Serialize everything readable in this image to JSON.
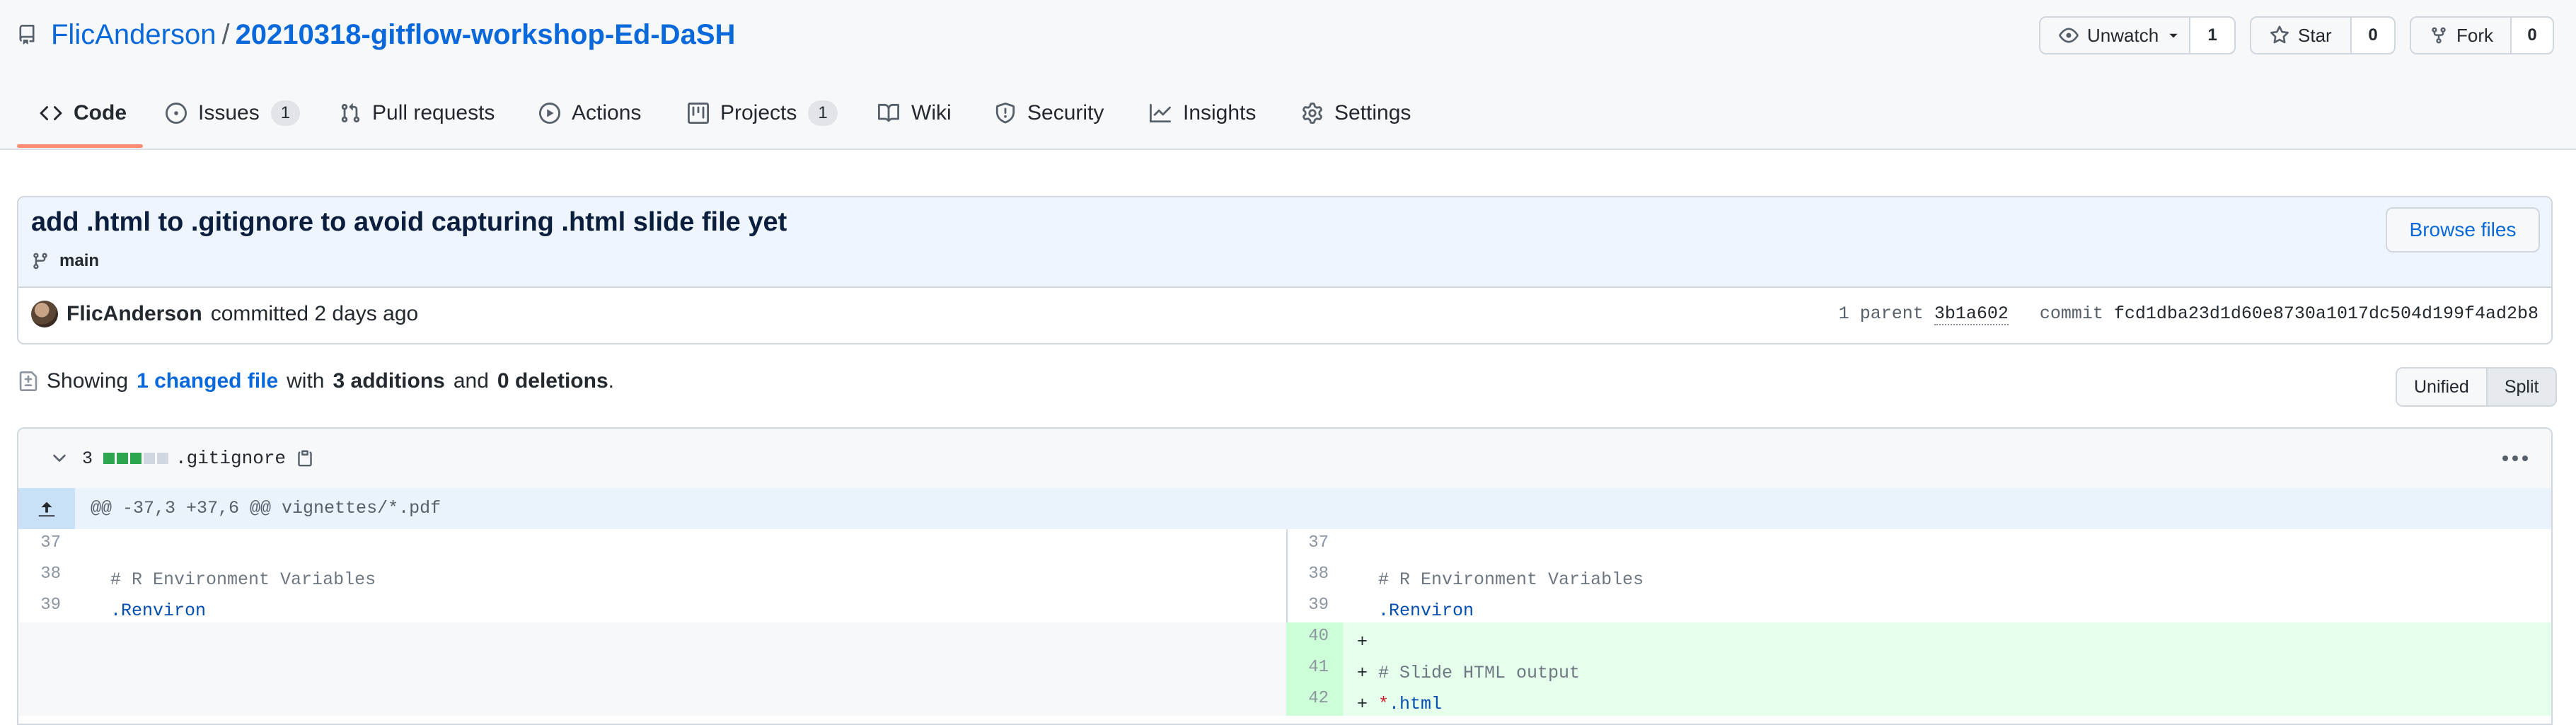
{
  "repo": {
    "owner": "FlicAnderson",
    "separator": "/",
    "name": "20210318-gitflow-workshop-Ed-DaSH"
  },
  "actions": {
    "unwatch": {
      "label": "Unwatch",
      "count": "1"
    },
    "star": {
      "label": "Star",
      "count": "0"
    },
    "fork": {
      "label": "Fork",
      "count": "0"
    }
  },
  "tabs": [
    {
      "label": "Code",
      "icon": "code-icon"
    },
    {
      "label": "Issues",
      "count": "1",
      "icon": "issue-icon"
    },
    {
      "label": "Pull requests",
      "icon": "pull-request-icon"
    },
    {
      "label": "Actions",
      "icon": "play-icon"
    },
    {
      "label": "Projects",
      "count": "1",
      "icon": "project-icon"
    },
    {
      "label": "Wiki",
      "icon": "book-icon"
    },
    {
      "label": "Security",
      "icon": "shield-icon"
    },
    {
      "label": "Insights",
      "icon": "graph-icon"
    },
    {
      "label": "Settings",
      "icon": "gear-icon"
    }
  ],
  "commit": {
    "title": "add .html to .gitignore to avoid capturing .html slide file yet",
    "branch": "main",
    "browse_label": "Browse files",
    "author": "FlicAnderson",
    "committed_text": "committed 2 days ago",
    "parent_label": "1 parent",
    "parent_hash": "3b1a602",
    "commit_label": "commit",
    "commit_hash": "fcd1dba23d1d60e8730a1017dc504d199f4ad2b8"
  },
  "summary": {
    "prefix": "Showing",
    "changed": "1 changed file",
    "with": "with",
    "additions": "3 additions",
    "and": "and",
    "deletions": "0 deletions",
    "suffix": "."
  },
  "view_toggle": {
    "unified": "Unified",
    "split": "Split",
    "selected": "Split"
  },
  "file": {
    "change_count": "3",
    "diffstat": [
      "added",
      "added",
      "added",
      "neutral",
      "neutral"
    ],
    "name": ".gitignore",
    "hunk_header": "@@ -37,3 +37,6 @@ vignettes/*.pdf",
    "left_lines": [
      {
        "num": "37",
        "text": ""
      },
      {
        "num": "38",
        "text": "  # R Environment Variables"
      },
      {
        "num": "39",
        "text": "  .Renviron"
      }
    ],
    "right_lines": [
      {
        "num": "37",
        "text": ""
      },
      {
        "num": "38",
        "text": "  # R Environment Variables"
      },
      {
        "num": "39",
        "text": "  .Renviron"
      },
      {
        "num": "40",
        "text": "+ "
      },
      {
        "num": "41",
        "text": "+ # Slide HTML output"
      },
      {
        "num": "42",
        "text": "+ *.html"
      }
    ]
  },
  "colors": {
    "link": "#0969da",
    "tab_underline": "#fd8c73",
    "addition_bg": "#e6ffec",
    "addition_num_bg": "#ccffd8",
    "diffstat_added": "#2da44e",
    "diffstat_neutral": "#d0d7de"
  }
}
